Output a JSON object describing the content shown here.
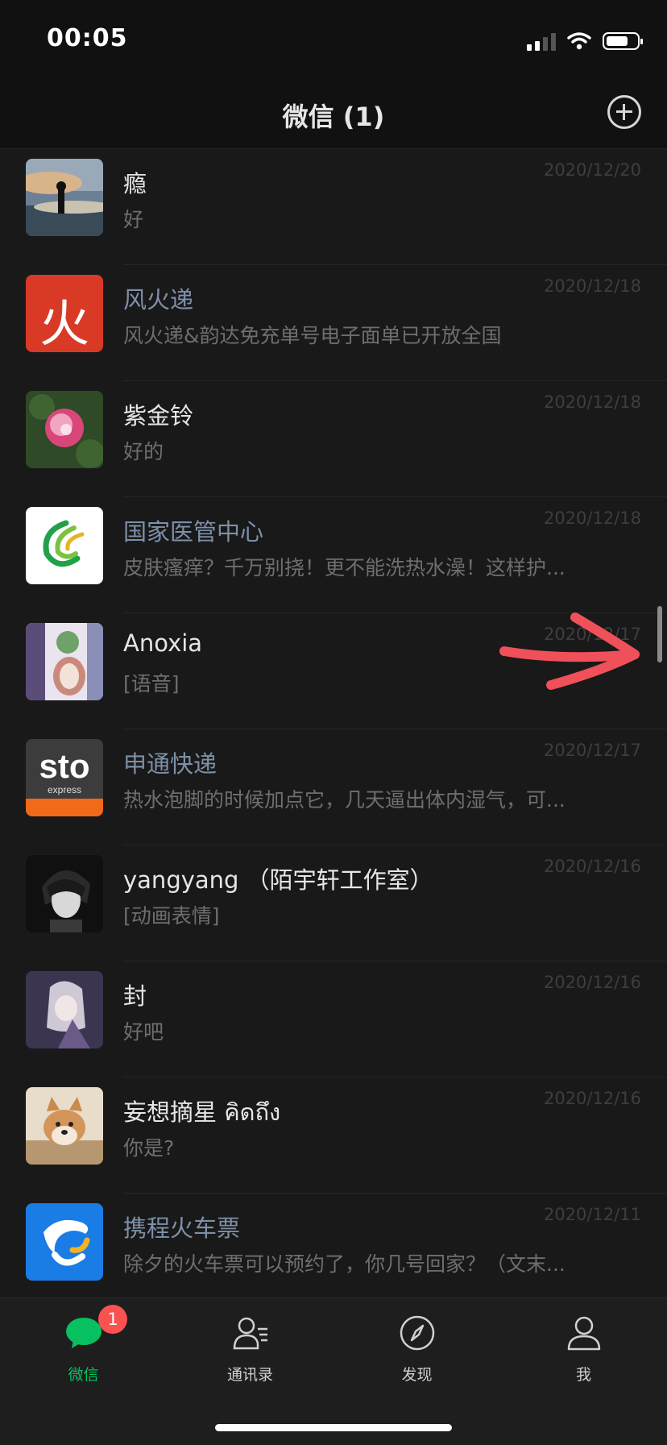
{
  "status_bar": {
    "time": "00:05"
  },
  "header": {
    "title": "微信 (1)"
  },
  "chats": [
    {
      "name": "瘾",
      "preview": "好",
      "date": "2020/12/20",
      "official": false,
      "avatar": "sunset-silhouette"
    },
    {
      "name": "风火递",
      "preview": "风火递&韵达免充单号电子面单已开放全国",
      "date": "2020/12/18",
      "official": true,
      "avatar_text": "火"
    },
    {
      "name": "紫金铃",
      "preview": "好的",
      "date": "2020/12/18",
      "official": false,
      "avatar": "peony-flower"
    },
    {
      "name": "国家医管中心",
      "preview": "皮肤瘙痒？千万别挠！更不能洗热水澡！这样护...",
      "date": "2020/12/18",
      "official": true,
      "avatar": "green-swirl-logo"
    },
    {
      "name": "Anoxia",
      "preview": "[语音]",
      "date": "2020/12/17",
      "official": false,
      "avatar": "anime-illustration"
    },
    {
      "name": "申通快递",
      "preview": "热水泡脚的时候加点它，几天逼出体内湿气，可...",
      "date": "2020/12/17",
      "official": true,
      "avatar_text": "sto",
      "avatar_subtext": "express"
    },
    {
      "name": "yangyang （陌宇轩工作室）",
      "preview": "[动画表情]",
      "date": "2020/12/16",
      "official": false,
      "avatar": "anime-boy-monochrome"
    },
    {
      "name": "封",
      "preview": "好吧",
      "date": "2020/12/16",
      "official": false,
      "avatar": "anime-character"
    },
    {
      "name": "妄想摘星 คิดถึง",
      "preview": "你是?",
      "date": "2020/12/16",
      "official": false,
      "avatar": "shiba-dog"
    },
    {
      "name": "携程火车票",
      "preview": "除夕的火车票可以预约了，你几号回家？（文末...",
      "date": "2020/12/11",
      "official": true,
      "avatar": "dolphin-logo"
    }
  ],
  "tabs": [
    {
      "label": "微信",
      "icon": "chat-bubble-icon",
      "active": true,
      "badge": "1"
    },
    {
      "label": "通讯录",
      "icon": "contacts-icon",
      "active": false
    },
    {
      "label": "发现",
      "icon": "compass-icon",
      "active": false
    },
    {
      "label": "我",
      "icon": "person-icon",
      "active": false
    }
  ],
  "colors": {
    "accent": "#07c160",
    "badge": "#fa5151",
    "background": "#191919",
    "official_name": "#7d90a9",
    "annotation_arrow": "#f0505a"
  }
}
